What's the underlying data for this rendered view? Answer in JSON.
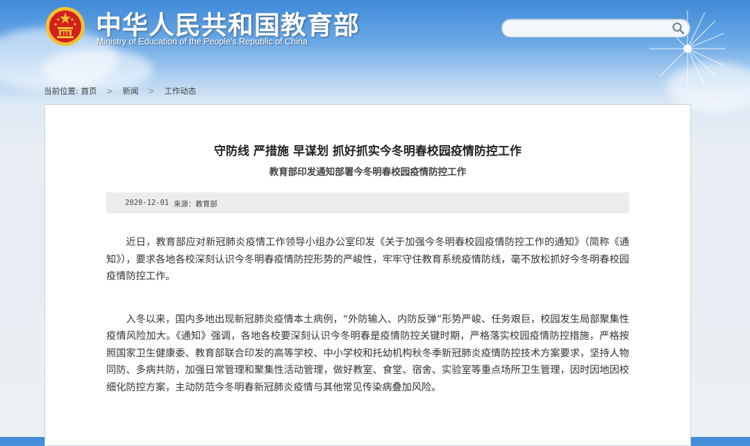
{
  "header": {
    "title": "中华人民共和国教育部",
    "subtitle": "Ministry of Education of the People's Republic of China"
  },
  "search": {
    "value": "",
    "placeholder": ""
  },
  "breadcrumb": {
    "label": "当前位置:",
    "items": [
      "首页",
      "新闻",
      "工作动态"
    ]
  },
  "article": {
    "title": "守防线 严措施 早谋划 抓好抓实今冬明春校园疫情防控工作",
    "subtitle": "教育部印发通知部署今冬明春校园疫情防控工作",
    "date": "2020-12-01",
    "source": "来源：教育部",
    "paragraphs": [
      "近日，教育部应对新冠肺炎疫情工作领导小组办公室印发《关于加强今冬明春校园疫情防控工作的通知》（简称《通知》），要求各地各校深刻认识今冬明春疫情防控形势的严峻性，牢牢守住教育系统疫情防线，毫不放松抓好今冬明春校园疫情防控工作。",
      "入冬以来，国内多地出现新冠肺炎疫情本土病例，“外防输入、内防反弹”形势严峻、任务艰巨，校园发生局部聚集性疫情风险加大。《通知》强调，各地各校要深刻认识今冬明春是疫情防控关键时期，严格落实校园疫情防控措施，严格按照国家卫生健康委、教育部联合印发的高等学校、中小学校和托幼机构秋冬季新冠肺炎疫情防控技术方案要求，坚持人物同防、多病共防，加强日常管理和聚集性活动管理，做好教室、食堂、宿舍、实验室等重点场所卫生管理，因时因地因校细化防控方案，主动防范今冬明春新冠肺炎疫情与其他常见传染病叠加风险。"
    ]
  },
  "colors": {
    "header_blue": "#3f8ad8",
    "emblem_red": "#d21f1f",
    "emblem_gold": "#f2c230"
  }
}
